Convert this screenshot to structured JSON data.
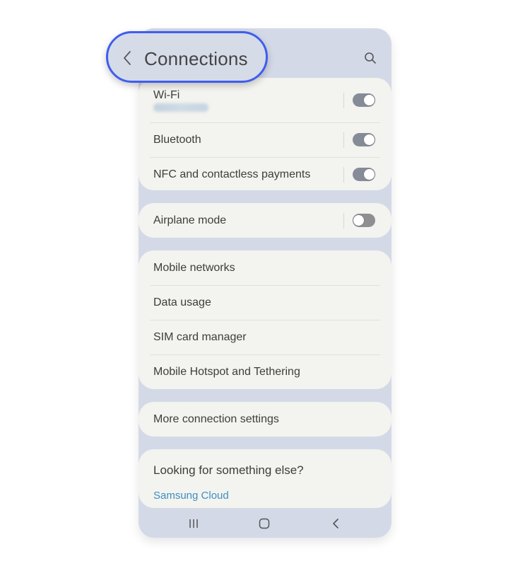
{
  "header": {
    "title": "Connections",
    "back_icon": "chevron-left-icon",
    "search_icon": "search-icon"
  },
  "groups": [
    {
      "items": [
        {
          "label": "Wi-Fi",
          "subtitle_blurred": true,
          "toggle": "on"
        },
        {
          "label": "Bluetooth",
          "toggle": "on"
        },
        {
          "label": "NFC and contactless payments",
          "toggle": "on"
        }
      ]
    },
    {
      "items": [
        {
          "label": "Airplane mode",
          "toggle": "off"
        }
      ]
    },
    {
      "items": [
        {
          "label": "Mobile networks"
        },
        {
          "label": "Data usage"
        },
        {
          "label": "SIM card manager"
        },
        {
          "label": "Mobile Hotspot and Tethering"
        }
      ]
    },
    {
      "items": [
        {
          "label": "More connection settings"
        }
      ]
    }
  ],
  "suggestion": {
    "title": "Looking for something else?",
    "link": "Samsung Cloud"
  },
  "navbar": {
    "recents_icon": "recent-apps-icon",
    "home_icon": "home-icon",
    "back_icon": "back-icon"
  },
  "colors": {
    "highlight": "#3e5df0",
    "link": "#3d8fc4",
    "toggle_on": "#858c98",
    "toggle_off": "#8f8f8f"
  }
}
